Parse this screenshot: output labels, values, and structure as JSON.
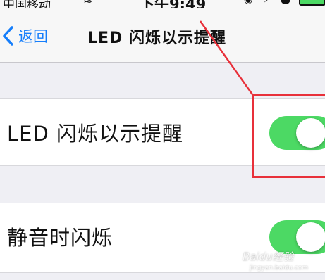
{
  "status_bar": {
    "carrier": "中国移动",
    "wifi_icon": "wifi-icon",
    "time": "下午9:49",
    "lock_icon": "rotation-lock-icon",
    "bolt_icon": "charging-bolt-icon",
    "battery_color": "#4cd964"
  },
  "nav": {
    "back_label": "返回",
    "title": "LED 闪烁以示提醒"
  },
  "settings": {
    "rows": [
      {
        "label": "LED 闪烁以示提醒",
        "toggle_on": true
      },
      {
        "label": "静音时闪烁",
        "toggle_on": true
      }
    ]
  },
  "colors": {
    "accent": "#157efb",
    "toggle_on": "#4cd964",
    "annotation": "#e8303a",
    "background": "#efeff4"
  },
  "watermark": {
    "text": "Baidu经验",
    "sub": "jingyan.baidu.com"
  }
}
